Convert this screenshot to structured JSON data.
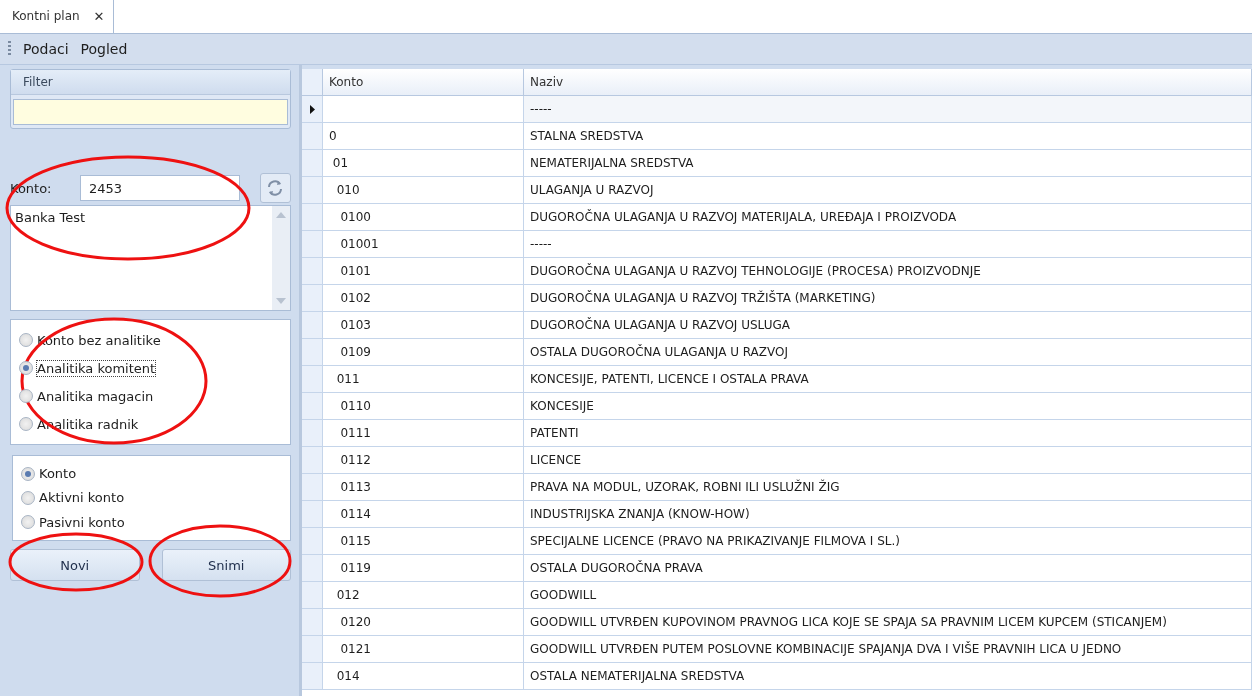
{
  "tabs": [
    {
      "label": "Kontni plan",
      "selected": true,
      "close": "✕"
    }
  ],
  "menu": [
    "Podaci",
    "Pogled"
  ],
  "filter": {
    "title": "Filter"
  },
  "konto": {
    "label": "Konto:",
    "value": "2453",
    "description": "Banka Test"
  },
  "analytics": [
    {
      "label": "Konto bez analitike",
      "selected": false
    },
    {
      "label": "Analitika komitent",
      "selected": true
    },
    {
      "label": "Analitika magacin",
      "selected": false
    },
    {
      "label": "Analitika radnik",
      "selected": false
    }
  ],
  "account_type": [
    {
      "label": "Konto",
      "selected": true
    },
    {
      "label": "Aktivni konto",
      "selected": false
    },
    {
      "label": "Pasivni konto",
      "selected": false
    }
  ],
  "buttons": [
    "Novi",
    "Snimi"
  ],
  "table": {
    "columns": [
      "Konto",
      "Naziv"
    ],
    "rows": [
      {
        "konto": "",
        "naziv": "-----",
        "current": true
      },
      {
        "konto": "0",
        "naziv": "STALNA SREDSTVA",
        "current": false
      },
      {
        "konto": " 01",
        "naziv": "NEMATERIJALNA SREDSTVA",
        "current": false
      },
      {
        "konto": "  010",
        "naziv": "ULAGANJA U RAZVOJ",
        "current": false
      },
      {
        "konto": "   0100",
        "naziv": "DUGOROČNA ULAGANJA U RAZVOJ MATERIJALA, UREĐAJA I PROIZVODA",
        "current": false
      },
      {
        "konto": "   01001",
        "naziv": "-----",
        "current": false
      },
      {
        "konto": "   0101",
        "naziv": "DUGOROČNA ULAGANJA U RAZVOJ TEHNOLOGIJE (PROCESA) PROIZVODNJE",
        "current": false
      },
      {
        "konto": "   0102",
        "naziv": "DUGOROČNA ULAGANJA U RAZVOJ TRŽIŠTA (MARKETING)",
        "current": false
      },
      {
        "konto": "   0103",
        "naziv": "DUGOROČNA ULAGANJA U RAZVOJ USLUGA",
        "current": false
      },
      {
        "konto": "   0109",
        "naziv": "OSTALA DUGOROČNA ULAGANJA U RAZVOJ",
        "current": false
      },
      {
        "konto": "  011",
        "naziv": "KONCESIJE, PATENTI, LICENCE I OSTALA PRAVA",
        "current": false
      },
      {
        "konto": "   0110",
        "naziv": "KONCESIJE",
        "current": false
      },
      {
        "konto": "   0111",
        "naziv": "PATENTI",
        "current": false
      },
      {
        "konto": "   0112",
        "naziv": "LICENCE",
        "current": false
      },
      {
        "konto": "   0113",
        "naziv": "PRAVA NA MODUL, UZORAK, ROBNI ILI USLUŽNI ŽIG",
        "current": false
      },
      {
        "konto": "   0114",
        "naziv": "INDUSTRIJSKA ZNANJA (KNOW-HOW)",
        "current": false
      },
      {
        "konto": "   0115",
        "naziv": "SPECIJALNE LICENCE (PRAVO NA PRIKAZIVANJE FILMOVA I SL.)",
        "current": false
      },
      {
        "konto": "   0119",
        "naziv": "OSTALA DUGOROČNA PRAVA",
        "current": false
      },
      {
        "konto": "  012",
        "naziv": "GOODWILL",
        "current": false
      },
      {
        "konto": "   0120",
        "naziv": "GOODWILL UTVRĐEN KUPOVINOM PRAVNOG LICA KOJE SE SPAJA SA PRAVNIM LICEM KUPCEM (STICANJEM)",
        "current": false
      },
      {
        "konto": "   0121",
        "naziv": "GOODWILL UTVRĐEN PUTEM POSLOVNE KOMBINACIJE SPAJANJA DVA I VIŠE PRAVNIH LICA U JEDNO",
        "current": false
      },
      {
        "konto": "  014",
        "naziv": "OSTALA NEMATERIJALNA SREDSTVA",
        "current": false
      }
    ]
  }
}
